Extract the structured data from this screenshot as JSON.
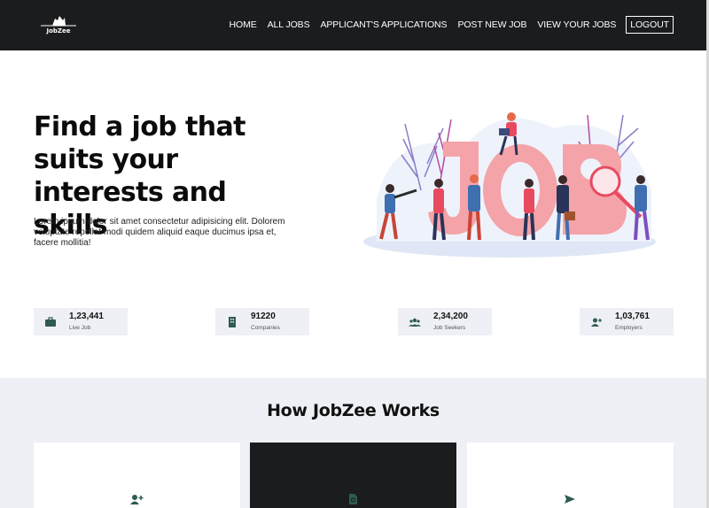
{
  "brand": {
    "name": "JobZee",
    "logo_icon": "laptop-logo-icon"
  },
  "nav": {
    "items": [
      {
        "label": "HOME"
      },
      {
        "label": "ALL JOBS"
      },
      {
        "label": "APPLICANT'S APPLICATIONS"
      },
      {
        "label": "POST NEW JOB"
      },
      {
        "label": "VIEW YOUR JOBS"
      }
    ],
    "logout_label": "LOGOUT"
  },
  "hero": {
    "title": "Find a job that suits your interests and skills",
    "description": "Lorem ipsum dolor sit amet consectetur adipisicing elit. Dolorem voluptate repellat modi quidem aliquid eaque ducimus ipsa et, facere mollitia!",
    "illustration": "job-search-illustration"
  },
  "stats": [
    {
      "value": "1,23,441",
      "label": "Live Job",
      "icon": "briefcase-icon"
    },
    {
      "value": "91220",
      "label": "Companies",
      "icon": "building-icon"
    },
    {
      "value": "2,34,200",
      "label": "Job Seekers",
      "icon": "users-icon"
    },
    {
      "value": "1,03,761",
      "label": "Employers",
      "icon": "user-plus-icon"
    }
  ],
  "how": {
    "title": "How JobZee Works",
    "cards": [
      {
        "icon": "user-plus-icon",
        "theme": "light"
      },
      {
        "icon": "file-search-icon",
        "theme": "dark"
      },
      {
        "icon": "send-icon",
        "theme": "light"
      }
    ]
  },
  "colors": {
    "navbar": "#1b1c1e",
    "accent": "#2e5b52",
    "section_bg": "#eef0f5",
    "illustration_letters": "#f4a3a8"
  }
}
